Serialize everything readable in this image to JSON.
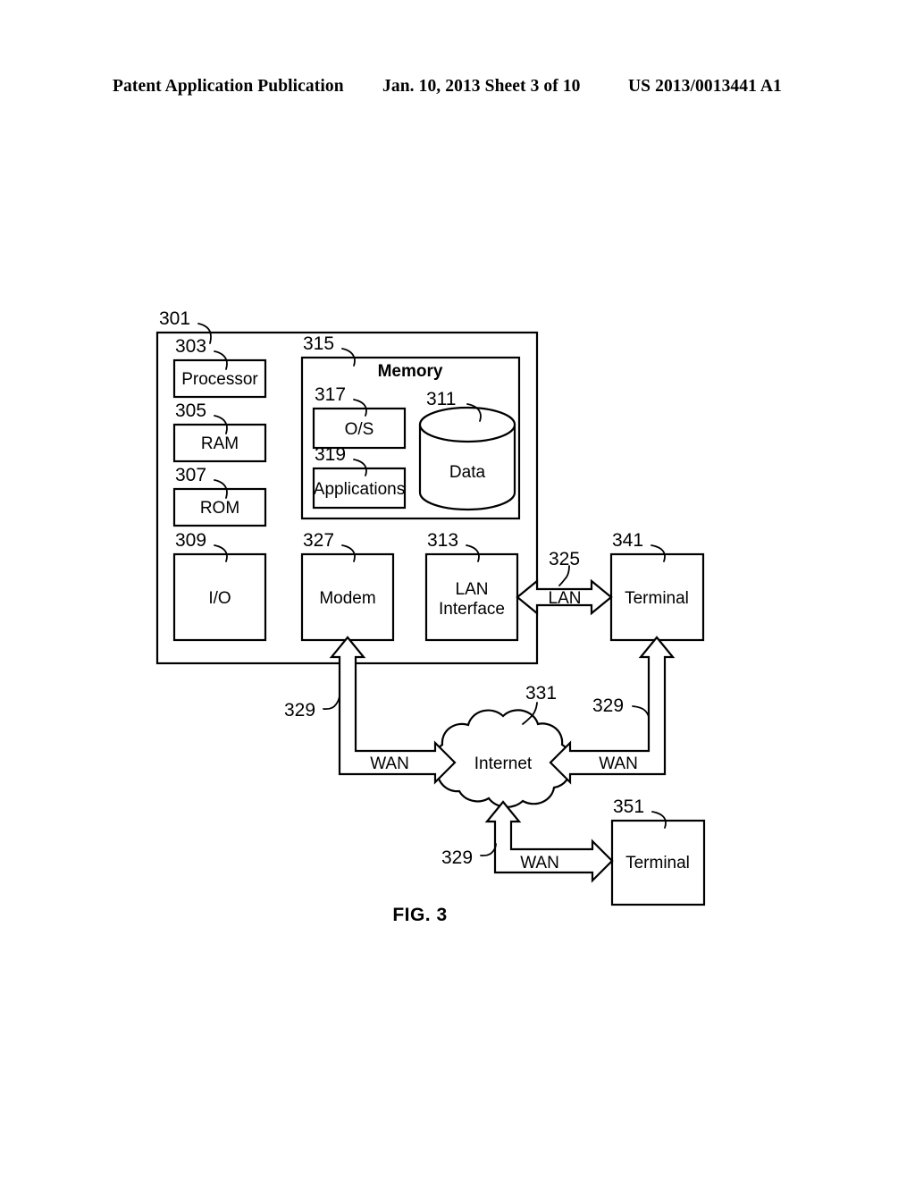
{
  "header": {
    "publication": "Patent Application Publication",
    "date_sheet": "Jan. 10, 2013  Sheet 3 of 10",
    "patent_number": "US 2013/0013441 A1"
  },
  "figure": {
    "caption": "FIG. 3",
    "blocks": {
      "computing_device": {
        "ref": "301",
        "label": ""
      },
      "processor": {
        "ref": "303",
        "label": "Processor"
      },
      "ram": {
        "ref": "305",
        "label": "RAM"
      },
      "rom": {
        "ref": "307",
        "label": "ROM"
      },
      "io": {
        "ref": "309",
        "label": "I/O"
      },
      "memory": {
        "ref": "315",
        "label": "Memory"
      },
      "os": {
        "ref": "317",
        "label": "O/S"
      },
      "applications": {
        "ref": "319",
        "label": "Applications"
      },
      "data": {
        "ref": "311",
        "label": "Data"
      },
      "modem": {
        "ref": "327",
        "label": "Modem"
      },
      "lan_interface": {
        "ref": "313",
        "label": "LAN\nInterface"
      },
      "lan_interface_line1": "LAN",
      "lan_interface_line2": "Interface",
      "terminal_341": {
        "ref": "341",
        "label": "Terminal"
      },
      "terminal_351": {
        "ref": "351",
        "label": "Terminal"
      },
      "internet": {
        "ref": "331",
        "label": "Internet"
      }
    },
    "links": {
      "lan": {
        "ref": "325",
        "label": "LAN"
      },
      "wan_left": {
        "ref": "329",
        "label": "WAN"
      },
      "wan_right": {
        "ref": "329",
        "label": "WAN"
      },
      "wan_bottom": {
        "ref": "329",
        "label": "WAN"
      }
    }
  },
  "colors": {
    "ink": "#000000",
    "paper": "#ffffff"
  }
}
